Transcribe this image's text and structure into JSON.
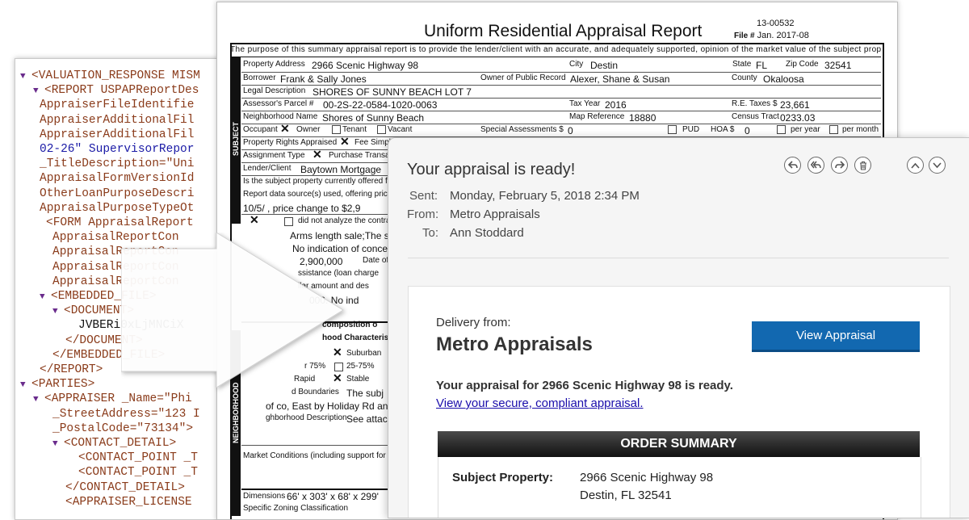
{
  "xml": {
    "lines": [
      {
        "tri": "▼",
        "tag": "<VALUATION_RESPONSE MISM",
        "rest": ""
      },
      {
        "tri": "▼",
        "tag": "<REPORT USPAPReportDes",
        "rest": ""
      },
      {
        "tri": "",
        "tag": "AppraiserFileIdentifie",
        "rest": ""
      },
      {
        "tri": "",
        "tag": "AppraiserAdditionalFil",
        "rest": ""
      },
      {
        "tri": "",
        "tag": "AppraiserAdditionalFil",
        "rest": ""
      },
      {
        "tri": "",
        "tag": "",
        "rest": "02-26\" SupervisorRepor"
      },
      {
        "tri": "",
        "tag": "_TitleDescription=\"Uni",
        "rest": ""
      },
      {
        "tri": "",
        "tag": "AppraisalFormVersionId",
        "rest": ""
      },
      {
        "tri": "",
        "tag": "OtherLoanPurposeDescri",
        "rest": ""
      },
      {
        "tri": "",
        "tag": "AppraisalPurposeTypeOt",
        "rest": ""
      },
      {
        "tri": "",
        "tag": "<FORM AppraisalReport",
        "rest": ""
      },
      {
        "tri": "",
        "tag": "AppraisalReportCon",
        "rest": ""
      },
      {
        "tri": "",
        "tag": "AppraisalReportCon",
        "rest": ""
      },
      {
        "tri": "",
        "tag": "AppraisalReportCon",
        "rest": ""
      },
      {
        "tri": "",
        "tag": "AppraisalReportCon",
        "rest": ""
      },
      {
        "tri": "▼",
        "tag": "<EMBEDDED_FILE>",
        "rest": ""
      },
      {
        "tri": "▼",
        "tag": "<DOCUMENT>",
        "rest": ""
      },
      {
        "tri": "",
        "tag": "",
        "rest": "JVBERi0xLjMNCiX"
      },
      {
        "tri": "",
        "tag": "</DOCUMENT>",
        "rest": ""
      },
      {
        "tri": "",
        "tag": "</EMBEDDED_FILE>",
        "rest": ""
      },
      {
        "tri": "",
        "tag": "</REPORT>",
        "rest": ""
      },
      {
        "tri": "▼",
        "tag": "<PARTIES>",
        "rest": ""
      },
      {
        "tri": "▼",
        "tag": "<APPRAISER _Name=\"Phi",
        "rest": ""
      },
      {
        "tri": "",
        "tag": "_StreetAddress=\"123 I",
        "rest": ""
      },
      {
        "tri": "",
        "tag": "_PostalCode=\"73134\">",
        "rest": ""
      },
      {
        "tri": "▼",
        "tag": "<CONTACT_DETAIL>",
        "rest": ""
      },
      {
        "tri": "",
        "tag": "<CONTACT_POINT _T",
        "rest": ""
      },
      {
        "tri": "",
        "tag": "<CONTACT_POINT _T",
        "rest": ""
      },
      {
        "tri": "",
        "tag": "</CONTACT_DETAIL>",
        "rest": ""
      },
      {
        "tri": "",
        "tag": "<APPRAISER_LICENSE",
        "rest": ""
      }
    ]
  },
  "form": {
    "title": "Uniform Residential Appraisal Report",
    "file_number": "13-00532",
    "file_label": "File #",
    "file_date": "Jan. 2017-08",
    "purpose": "The purpose of this summary appraisal report is to provide the lender/client with an accurate, and adequately supported, opinion of the market value of the subject property.",
    "section_subject": "SUBJECT",
    "section_neighborhood": "NEIGHBORHOOD",
    "fields": {
      "property_address_label": "Property Address",
      "property_address": "2966 Scenic Highway 98",
      "city_label": "City",
      "city": "Destin",
      "state_label": "State",
      "state": "FL",
      "zip_label": "Zip Code",
      "zip": "32541",
      "borrower_label": "Borrower",
      "borrower": "Frank & Sally Jones",
      "owner_label": "Owner of Public Record",
      "owner": "Alexer, Shane & Susan",
      "county_label": "County",
      "county": "Okaloosa",
      "legal_label": "Legal Description",
      "legal": "SHORES OF SUNNY BEACH LOT 7",
      "parcel_label": "Assessor's Parcel #",
      "parcel": "00-2S-22-0584-1020-0063",
      "taxyear_label": "Tax Year",
      "taxyear": "2016",
      "retaxes_label": "R.E. Taxes $",
      "retaxes": "23,661",
      "neighborhood_label": "Neighborhood Name",
      "neighborhood": "Shores of Sunny Beach",
      "mapref_label": "Map Reference",
      "mapref": "18880",
      "census_label": "Census Tract",
      "census": "0233.03",
      "occupant_label": "Occupant",
      "owner_opt": "Owner",
      "tenant_opt": "Tenant",
      "vacant_opt": "Vacant",
      "special_label": "Special Assessments $",
      "special": "0",
      "pud_label": "PUD",
      "hoa_label": "HOA $",
      "hoa": "0",
      "peryear": "per year",
      "permonth": "per month",
      "rights_label": "Property Rights Appraised",
      "rights_opt": "Fee Simpl",
      "assignment_label": "Assignment Type",
      "assignment_opt": "Purchase Transac",
      "lender_label": "Lender/Client",
      "lender": "Baytown Mortgage",
      "offered_label": "Is the subject property currently offered for s",
      "datasource_label": "Report data source(s) used, offering price(s)",
      "price_line": "10/5/         , price change to $2,9",
      "did_line": "did not analyze the contrac",
      "arms_line": "Arms length sale;The s",
      "noind_line": "No indication of conce",
      "price2": "2,900,000",
      "dateof": "Date of",
      "assist_line": "ssistance (loan charge",
      "dollar_line": "llar amount and des",
      "noind2": "000. No ind",
      "composition": "composition o",
      "hood_char": "hood Characterist",
      "suburban": "Suburban",
      "over75": "r 75%",
      "range2575": "25-75%",
      "rapid": "Rapid",
      "stable": "Stable",
      "boundaries": "d Boundaries",
      "boundaries_val": "The subj",
      "eastby": "of co, East by Holiday Rd an",
      "desc_label": "ghborhood Description",
      "desc_val": "See attac",
      "market_label": "Market Conditions (including support for the",
      "dimensions_label": "Dimensions",
      "dimensions": "66' x 303' x 68' x 299'",
      "zoning_label": "Specific Zoning Classification"
    }
  },
  "email": {
    "subject": "Your appraisal is ready!",
    "sent_label": "Sent:",
    "sent": "Monday, February 5, 2018 2:34 PM",
    "from_label": "From:",
    "from": "Metro Appraisals",
    "to_label": "To:",
    "to": "Ann Stoddard",
    "delivery_from": "Delivery from:",
    "company": "Metro Appraisals",
    "button": "View Appraisal",
    "ready_line": "Your appraisal for 2966 Scenic Highway 98 is ready.",
    "link": "View your secure, compliant appraisal.",
    "summary_title": "ORDER SUMMARY",
    "subject_property_label": "Subject Property:",
    "address1": "2966 Scenic Highway 98",
    "address2": "Destin, FL 32541"
  },
  "colors": {
    "button": "#1268b0",
    "link": "#1a0dab",
    "xml_tag": "#8a3b1a",
    "xml_value": "#1a1aa6"
  }
}
